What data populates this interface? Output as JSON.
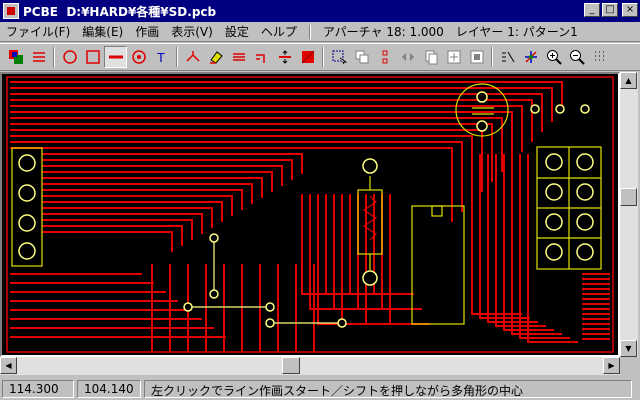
{
  "window": {
    "app_name": "PCBE",
    "file_path": "D:¥HARD¥各種¥SD.pcb",
    "minimize": "_",
    "maximize": "□",
    "close": "×"
  },
  "menu": {
    "items": [
      {
        "label": "ファイル(F)"
      },
      {
        "label": "編集(E)"
      },
      {
        "label": "作画"
      },
      {
        "label": "表示(V)"
      },
      {
        "label": "設定"
      },
      {
        "label": "ヘルプ"
      }
    ],
    "aperture": "アパーチャ 18: 1.000",
    "layer": "レイヤー 1: パターン1"
  },
  "toolbar": {
    "tools": [
      {
        "icon": "layer-color-icon"
      },
      {
        "icon": "route-icon"
      },
      {
        "icon": "circle-icon"
      },
      {
        "icon": "rectangle-icon"
      },
      {
        "icon": "line-icon",
        "pressed": true
      },
      {
        "icon": "pad-icon"
      },
      {
        "icon": "text-icon"
      },
      {
        "icon": "junction-icon"
      },
      {
        "icon": "eraser-icon"
      },
      {
        "icon": "bus-icon"
      },
      {
        "icon": "corner-icon"
      },
      {
        "icon": "resize-icon"
      },
      {
        "icon": "fill-icon"
      },
      {
        "icon": "select-icon"
      },
      {
        "icon": "copy-icon"
      },
      {
        "icon": "move-icon"
      },
      {
        "icon": "mirror-icon"
      },
      {
        "icon": "duplicate-icon"
      },
      {
        "icon": "array-icon"
      },
      {
        "icon": "group-icon"
      },
      {
        "icon": "measure-icon"
      },
      {
        "icon": "origin-icon"
      },
      {
        "icon": "zoom-in-icon"
      },
      {
        "icon": "zoom-out-icon"
      },
      {
        "icon": "grid-icon"
      }
    ]
  },
  "status": {
    "x": "114.300",
    "y": "104.140",
    "message": "左クリックでライン作画スタート／シフトを押しながら多角形の中心"
  },
  "colors": {
    "trace": "#e00000",
    "pad": "#ffff80",
    "silk": "#e0e000",
    "board": "#000000"
  }
}
